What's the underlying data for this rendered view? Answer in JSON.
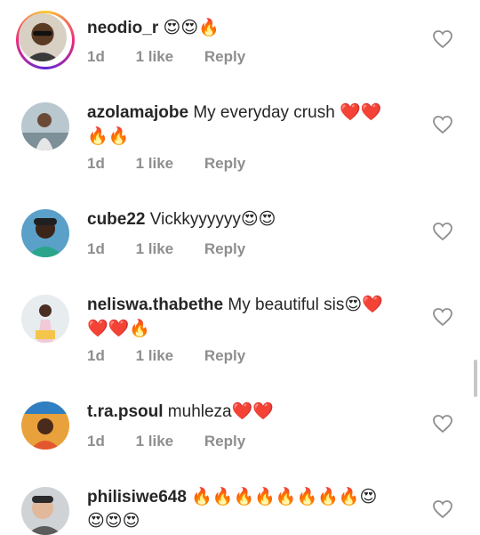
{
  "comments": [
    {
      "username": "neodio_r",
      "text": "",
      "emoji_line1": "😍😍🔥",
      "emoji_line2": "",
      "time": "1d",
      "likes": "1 like",
      "reply": "Reply"
    },
    {
      "username": "azolamajobe",
      "text": "My everyday crush",
      "emoji_line1": "❤️❤️",
      "emoji_line2": "🔥🔥",
      "time": "1d",
      "likes": "1 like",
      "reply": "Reply"
    },
    {
      "username": "cube22",
      "text": "Vickkyyyyyy",
      "emoji_line1": "😍😍",
      "emoji_line2": "",
      "time": "1d",
      "likes": "1 like",
      "reply": "Reply"
    },
    {
      "username": "neliswa.thabethe",
      "text": "My beautiful sis",
      "emoji_line1": "😍❤️",
      "emoji_line2": "❤️❤️🔥",
      "time": "1d",
      "likes": "1 like",
      "reply": "Reply"
    },
    {
      "username": "t.ra.psoul",
      "text": "muhleza",
      "emoji_line1": "❤️❤️",
      "emoji_line2": "",
      "time": "1d",
      "likes": "1 like",
      "reply": "Reply"
    },
    {
      "username": "philisiwe648",
      "text": "",
      "emoji_line1": "🔥🔥🔥🔥🔥🔥🔥🔥😍",
      "emoji_line2": "😍😍😍",
      "time": "",
      "likes": "",
      "reply": ""
    }
  ],
  "icons": {
    "like": "heart-outline-icon"
  },
  "colors": {
    "text": "#262626",
    "meta": "#8e8e8e",
    "heart_stroke": "#8e8e8e"
  }
}
